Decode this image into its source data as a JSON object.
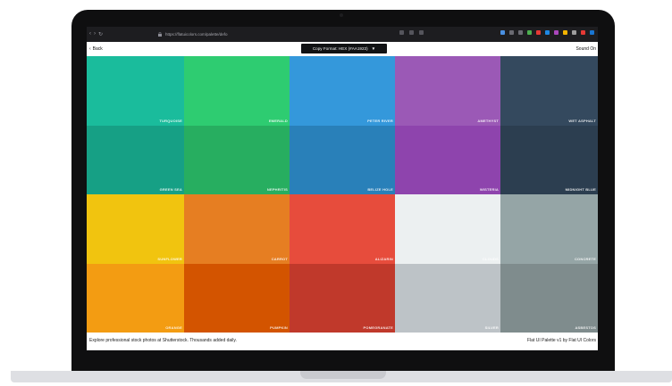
{
  "browser": {
    "nav": [
      "‹",
      "›",
      "↻"
    ],
    "url": "https://flatuicolors.com/palette/defo",
    "icon_colors": [
      "#4a90e2",
      "#6a6a72",
      "#6a6a72",
      "#4caf50",
      "#e53935",
      "#1e88e5",
      "#ab47bc",
      "#f4b400",
      "#9e9e9e",
      "#e53935",
      "#1976d2"
    ]
  },
  "header": {
    "back_label": "Back",
    "copy_format_label": "Copy Format: HEX (#AA1923)",
    "copy_format_arrow": "▼",
    "sound_label": "Sound On"
  },
  "palette": {
    "colors": [
      {
        "name": "Turquoise",
        "hex": "#1abc9c"
      },
      {
        "name": "Emerald",
        "hex": "#2ecc71"
      },
      {
        "name": "Peter River",
        "hex": "#3498db"
      },
      {
        "name": "Amethyst",
        "hex": "#9b59b6"
      },
      {
        "name": "Wet Asphalt",
        "hex": "#34495e"
      },
      {
        "name": "Green Sea",
        "hex": "#16a085"
      },
      {
        "name": "Nephritis",
        "hex": "#27ae60"
      },
      {
        "name": "Belize Hole",
        "hex": "#2980b9"
      },
      {
        "name": "Wisteria",
        "hex": "#8e44ad"
      },
      {
        "name": "Midnight Blue",
        "hex": "#2c3e50"
      },
      {
        "name": "Sunflower",
        "hex": "#f1c40f"
      },
      {
        "name": "Carrot",
        "hex": "#e67e22"
      },
      {
        "name": "Alizarin",
        "hex": "#e74c3c"
      },
      {
        "name": "Clouds",
        "hex": "#ecf0f1"
      },
      {
        "name": "Concrete",
        "hex": "#95a5a6"
      },
      {
        "name": "Orange",
        "hex": "#f39c12"
      },
      {
        "name": "Pumpkin",
        "hex": "#d35400"
      },
      {
        "name": "Pomegranate",
        "hex": "#c0392b"
      },
      {
        "name": "Silver",
        "hex": "#bdc3c7"
      },
      {
        "name": "Asbestos",
        "hex": "#7f8c8d"
      }
    ]
  },
  "footer": {
    "ad_text": "Explore professional stock photos at Shutterstock. Thousands added daily.",
    "credit_text": "Flat UI Palette v1 by Flat UI Colors"
  }
}
